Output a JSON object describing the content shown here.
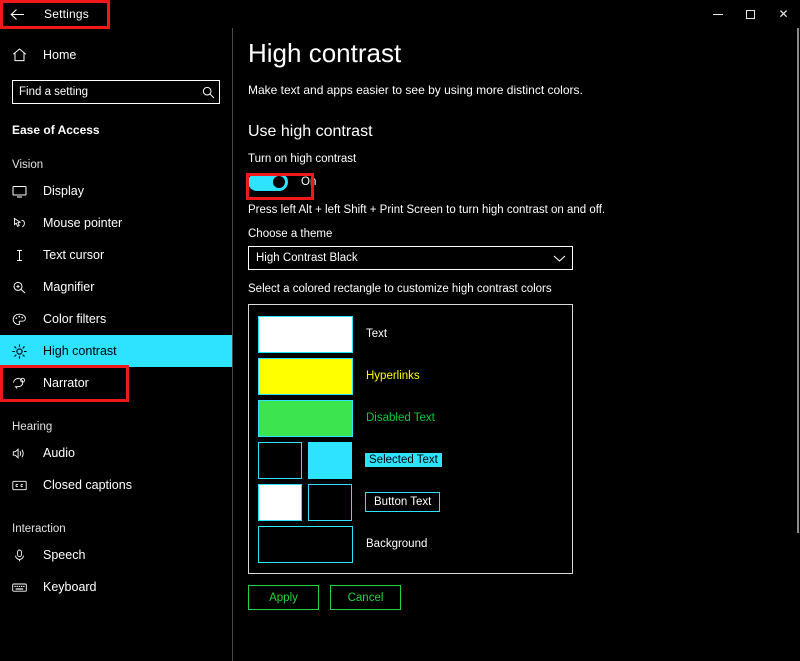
{
  "window": {
    "app_title": "Settings",
    "back_icon": "back-arrow-icon",
    "minimize_label": "–",
    "maximize_label": "□",
    "close_label": "✕"
  },
  "sidebar": {
    "home_label": "Home",
    "search": {
      "placeholder": "Find a setting",
      "value": "",
      "icon": "search-icon"
    },
    "section_title": "Ease of Access",
    "groups": [
      {
        "title": "Vision",
        "items": [
          {
            "label": "Display",
            "icon": "monitor-icon",
            "selected": false
          },
          {
            "label": "Mouse pointer",
            "icon": "mouse-pointer-icon",
            "selected": false
          },
          {
            "label": "Text cursor",
            "icon": "text-cursor-icon",
            "selected": false
          },
          {
            "label": "Magnifier",
            "icon": "magnifier-icon",
            "selected": false
          },
          {
            "label": "Color filters",
            "icon": "palette-icon",
            "selected": false
          },
          {
            "label": "High contrast",
            "icon": "sun-icon",
            "selected": true
          },
          {
            "label": "Narrator",
            "icon": "narrator-icon",
            "selected": false
          }
        ]
      },
      {
        "title": "Hearing",
        "items": [
          {
            "label": "Audio",
            "icon": "speaker-icon",
            "selected": false
          },
          {
            "label": "Closed captions",
            "icon": "closed-captions-icon",
            "selected": false
          }
        ]
      },
      {
        "title": "Interaction",
        "items": [
          {
            "label": "Speech",
            "icon": "microphone-icon",
            "selected": false
          },
          {
            "label": "Keyboard",
            "icon": "keyboard-icon",
            "selected": false
          }
        ]
      }
    ]
  },
  "main": {
    "title": "High contrast",
    "subtitle": "Make text and apps easier to see by using more distinct colors.",
    "section_heading": "Use high contrast",
    "toggle_label": "Turn on high contrast",
    "toggle_state": "On",
    "shortcut_hint": "Press left Alt + left Shift + Print Screen to turn high contrast on and off.",
    "theme_label": "Choose a theme",
    "theme_value": "High Contrast Black",
    "theme_caret_icon": "chevron-down-icon",
    "swatch_instruction": "Select a colored rectangle to customize high contrast colors",
    "swatches": [
      {
        "caption": "Text",
        "caption_style": "plain",
        "boxes": [
          {
            "fill": "#ffffff",
            "size": "wide"
          }
        ]
      },
      {
        "caption": "Hyperlinks",
        "caption_style": "link",
        "boxes": [
          {
            "fill": "#ffff00",
            "size": "wide"
          }
        ]
      },
      {
        "caption": "Disabled Text",
        "caption_style": "disabled",
        "boxes": [
          {
            "fill": "#3ce54f",
            "size": "wide"
          }
        ]
      },
      {
        "caption": "Selected Text",
        "caption_style": "selected",
        "boxes": [
          {
            "fill": "#000000",
            "size": "half"
          },
          {
            "fill": "#2ee3ff",
            "size": "half"
          }
        ]
      },
      {
        "caption": "Button Text",
        "caption_style": "buttonish",
        "boxes": [
          {
            "fill": "#ffffff",
            "size": "half"
          },
          {
            "fill": "#000000",
            "size": "half"
          }
        ]
      },
      {
        "caption": "Background",
        "caption_style": "plain",
        "boxes": [
          {
            "fill": "#000000",
            "size": "wide"
          }
        ]
      }
    ],
    "apply_label": "Apply",
    "cancel_label": "Cancel"
  },
  "colors": {
    "accent_cyan": "#2ee3ff",
    "hyperlink_yellow": "#ffff00",
    "disabled_green": "#3ce54f",
    "button_green": "#1fd63a",
    "annotation_red": "#f01818",
    "background_black": "#000000"
  }
}
